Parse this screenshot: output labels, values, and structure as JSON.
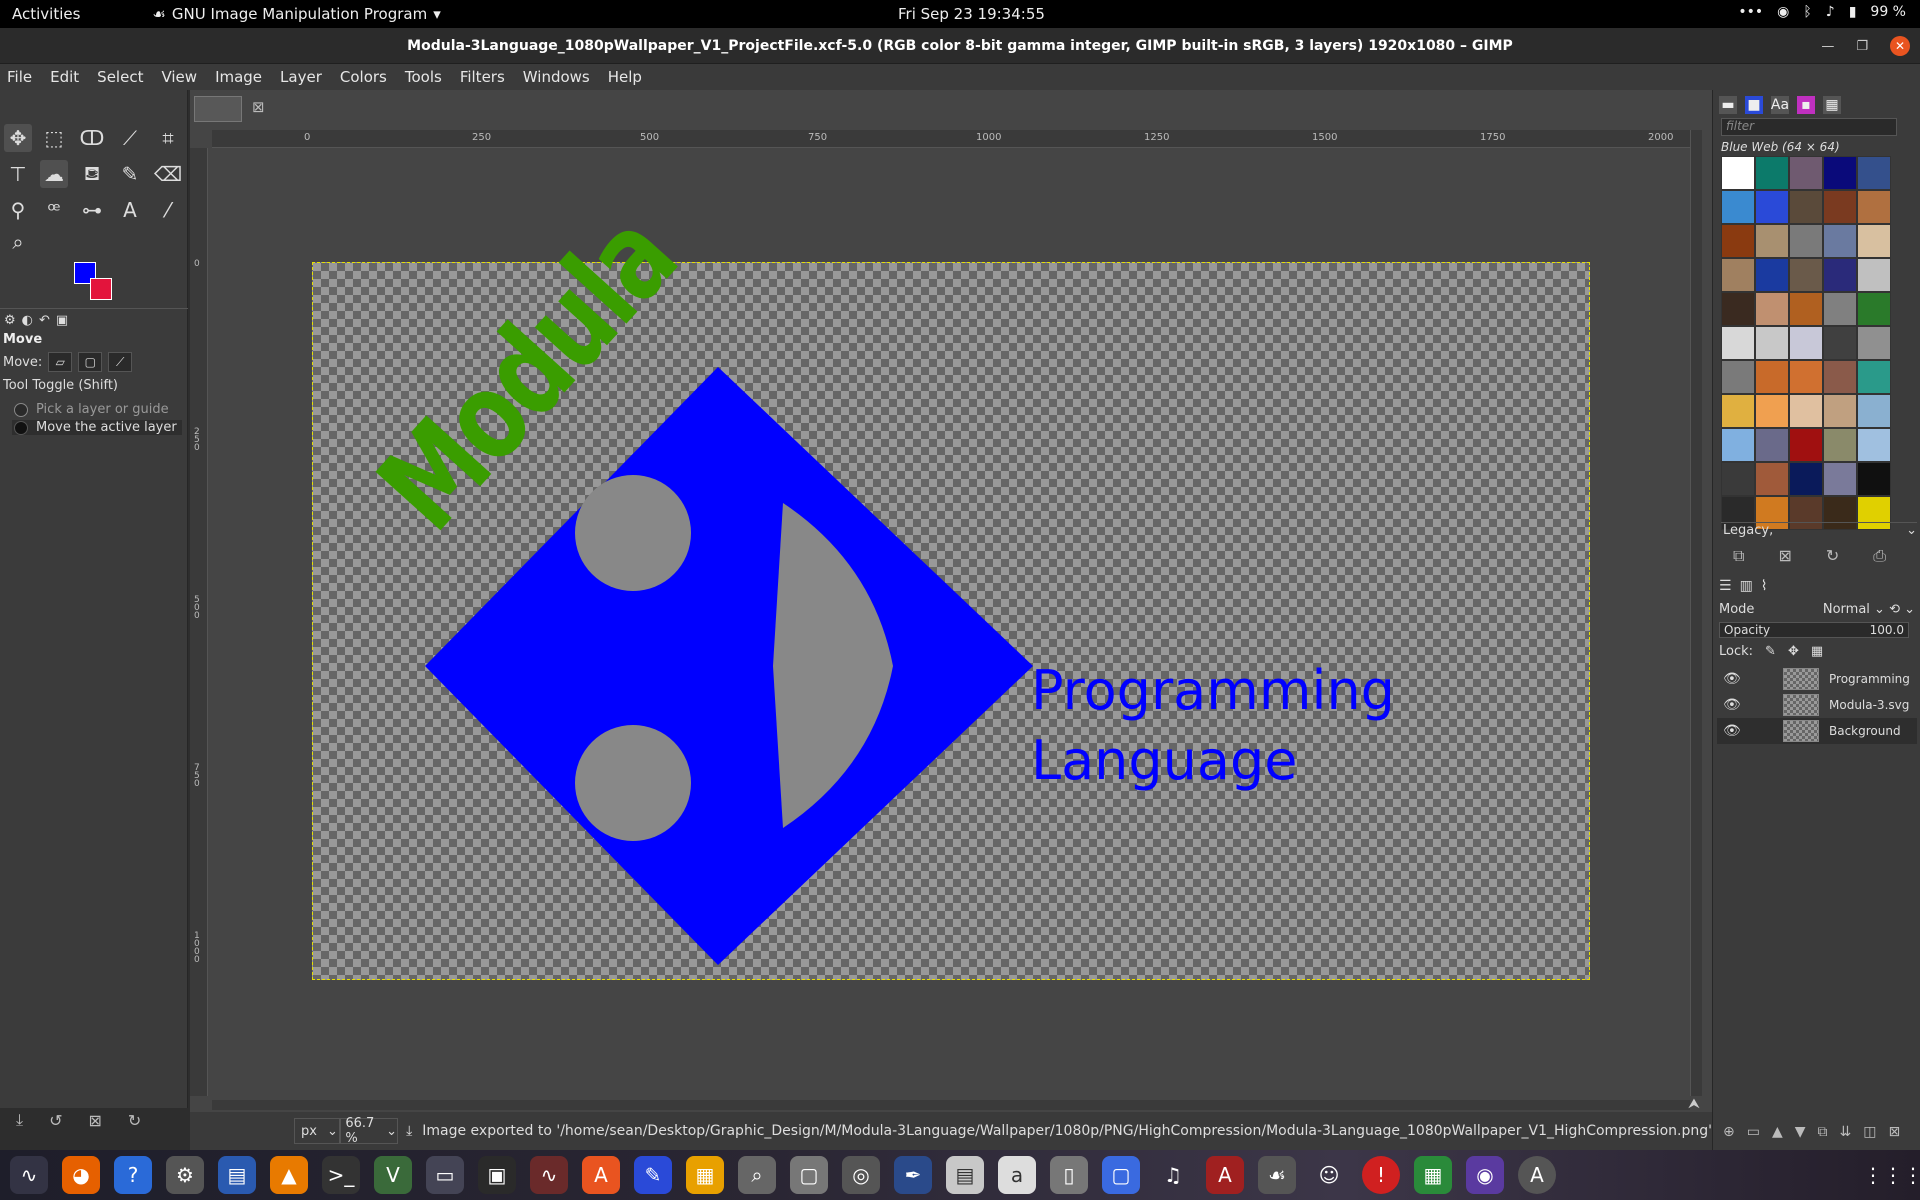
{
  "topbar": {
    "activities": "Activities",
    "app_name": "GNU Image Manipulation Program",
    "clock": "Fri Sep 23  19:34:55",
    "battery": "99 %"
  },
  "window": {
    "title": "Modula-3Language_1080pWallpaper_V1_ProjectFile.xcf-5.0 (RGB color 8-bit gamma integer, GIMP built-in sRGB, 3 layers) 1920x1080 – GIMP"
  },
  "menu": [
    "File",
    "Edit",
    "Select",
    "View",
    "Image",
    "Layer",
    "Colors",
    "Tools",
    "Filters",
    "Windows",
    "Help"
  ],
  "tool_options": {
    "heading": "Move",
    "move_label": "Move:",
    "toggle_label": "Tool Toggle  (Shift)",
    "option1": "Pick a layer or guide",
    "option2": "Move the active layer"
  },
  "colors": {
    "foreground": "#0000ff",
    "background": "#e3143c"
  },
  "ruler": {
    "h": [
      "0",
      "250",
      "500",
      "750",
      "1000",
      "1250",
      "1500",
      "1750",
      "2000"
    ],
    "v": [
      "0",
      "250",
      "500",
      "750",
      "1000"
    ]
  },
  "canvas": {
    "text_line1": "Programming",
    "text_line2": "Language",
    "logo_text": "Modula"
  },
  "status": {
    "unit": "px",
    "zoom": "66.7 %",
    "message": "Image exported to '/home/sean/Desktop/Graphic_Design/M/Modula-3Language/Wallpaper/1080p/PNG/HighCompression/Modula-3Language_1080pWallpaper_V1_HighCompression.png'"
  },
  "patterns": {
    "filter_placeholder": "filter",
    "title": "Blue Web (64 × 64)",
    "tag": "Legacy,",
    "swatches": [
      "#ffffff",
      "#0c7a6a",
      "#6f5a70",
      "#0a0a7a",
      "#34508c",
      "#3a8ad0",
      "#2a4ad8",
      "#5a4a3a",
      "#7a3a20",
      "#b07040",
      "#8a3a10",
      "#a89070",
      "#7a7a7a",
      "#6a7aa0",
      "#d8c0a0",
      "#a08060",
      "#1a3aa0",
      "#6a5a4a",
      "#2a2a7a",
      "#c0c0c0",
      "#3a2a20",
      "#c09070",
      "#b06020",
      "#808080",
      "#2a7a2a",
      "#d8d8d8",
      "#c8c8c8",
      "#c8c8d8",
      "#404040",
      "#909090",
      "#7a7a7a",
      "#c86a2a",
      "#d07030",
      "#8a5a4a",
      "#2a9a8a",
      "#e0b040",
      "#f0a050",
      "#e0c0a0",
      "#c0a080",
      "#8ab0d0",
      "#80b0e0",
      "#6a6a8a",
      "#a01010",
      "#8a8a6a",
      "#a0c0e0",
      "#3a3a3a",
      "#a05a3a",
      "#0a1a5a",
      "#7a7a9a",
      "#101010",
      "#2a2a2a",
      "#d07a20",
      "#5a3a2a",
      "#3a2a1a",
      "#e0d000"
    ]
  },
  "layers_panel": {
    "mode_label": "Mode",
    "mode_value": "Normal",
    "opacity_label": "Opacity",
    "opacity_value": "100.0",
    "lock_label": "Lock:",
    "layers": [
      {
        "name": "Programming"
      },
      {
        "name": "Modula-3.svg"
      },
      {
        "name": "Background"
      }
    ]
  }
}
